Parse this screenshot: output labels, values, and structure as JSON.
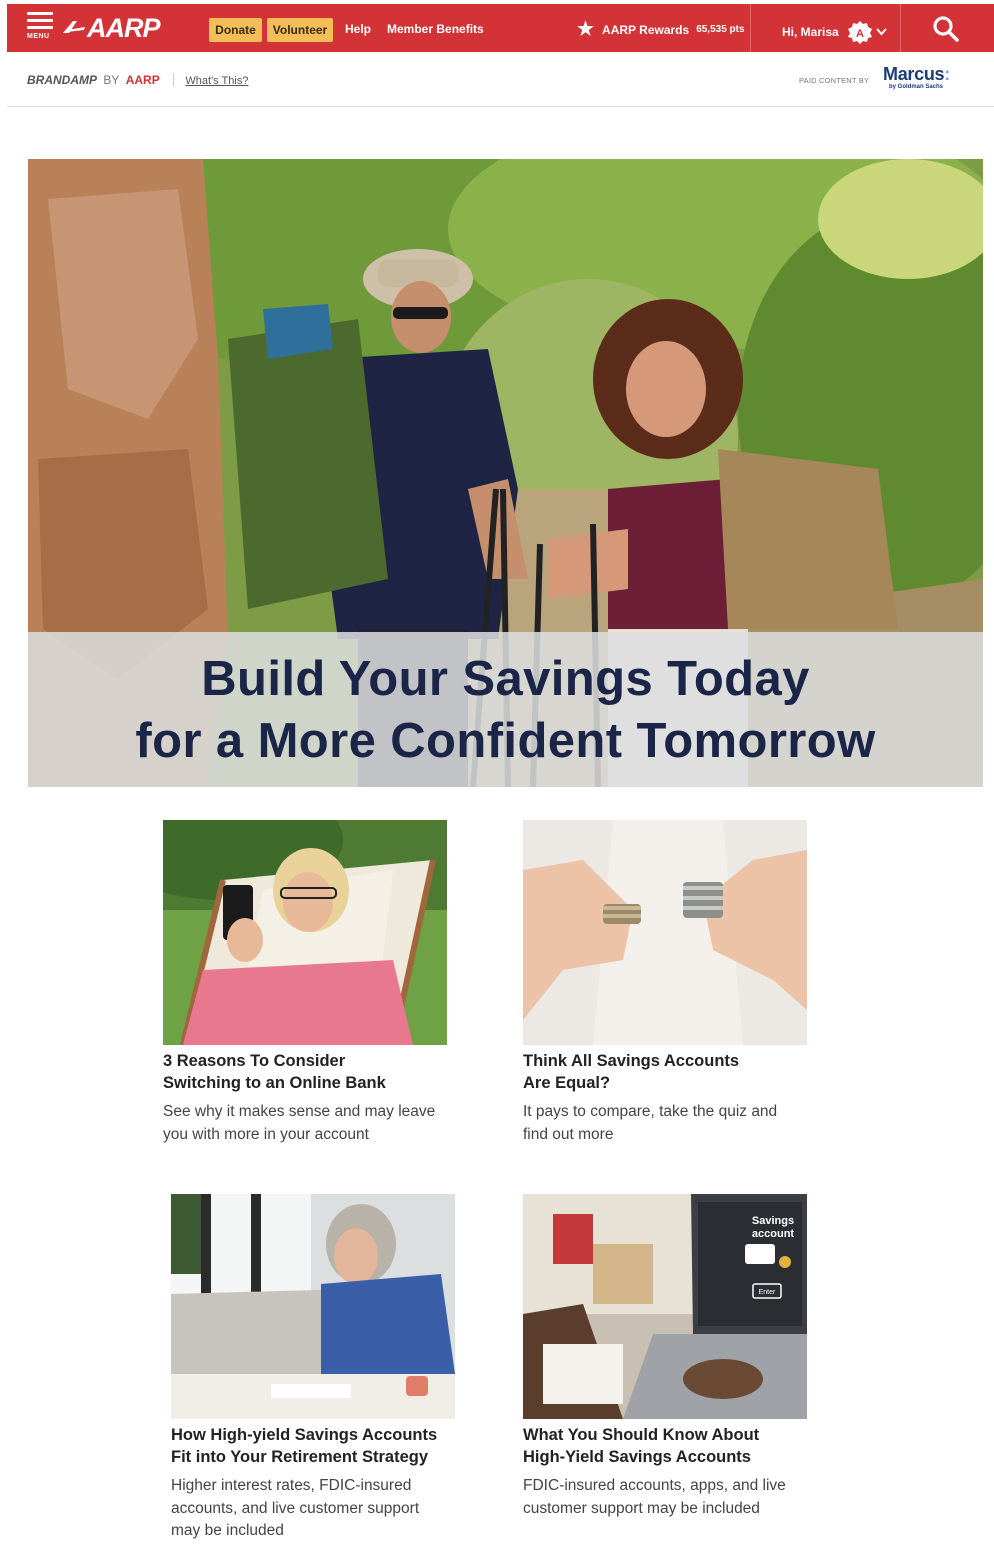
{
  "topnav": {
    "menu_label": "MENU",
    "logo_text": "AARP",
    "donate_label": "Donate",
    "volunteer_label": "Volunteer",
    "help_label": "Help",
    "member_benefits_label": "Member Benefits",
    "rewards_label": "AARP Rewards",
    "rewards_points": "65,535 pts",
    "greeting": "Hi, Marisa",
    "avatar_initial": "A",
    "colors": {
      "nav_bg": "#d33236",
      "button_yellow": "#f3bd57"
    },
    "icons": [
      "menu-icon",
      "star-icon",
      "member-badge-icon",
      "chevron-down-icon",
      "search-icon"
    ]
  },
  "brandbar": {
    "brand_name": "BRANDAMP",
    "by": "BY",
    "brand_owner": "AARP",
    "whats_this": "What's This?",
    "paid_content": "PAID CONTENT BY",
    "sponsor_name": "Marcus",
    "sponsor_tagline": "by Goldman Sachs"
  },
  "hero": {
    "headline_line1": "Build Your Savings Today",
    "headline_line2": "for a More Confident Tomorrow"
  },
  "cards": [
    {
      "title": "3 Reasons To Consider\nSwitching to an Online Bank",
      "description": "See why it makes sense and may leave\nyou with more in your account"
    },
    {
      "title": "Think All Savings Accounts\nAre Equal?",
      "description": "It pays to compare, take the quiz and\nfind out more"
    },
    {
      "title": "How High-yield Savings Accounts\nFit into Your Retirement Strategy",
      "description": "Higher interest rates, FDIC-insured\naccounts, and live customer support\nmay be included"
    },
    {
      "title": "What You Should Know About\nHigh-Yield Savings Accounts",
      "description": "FDIC-insured accounts, apps, and live\ncustomer support may be included",
      "image_text_line1": "Savings",
      "image_text_line2": "account",
      "image_text_button": "Enter"
    }
  ]
}
